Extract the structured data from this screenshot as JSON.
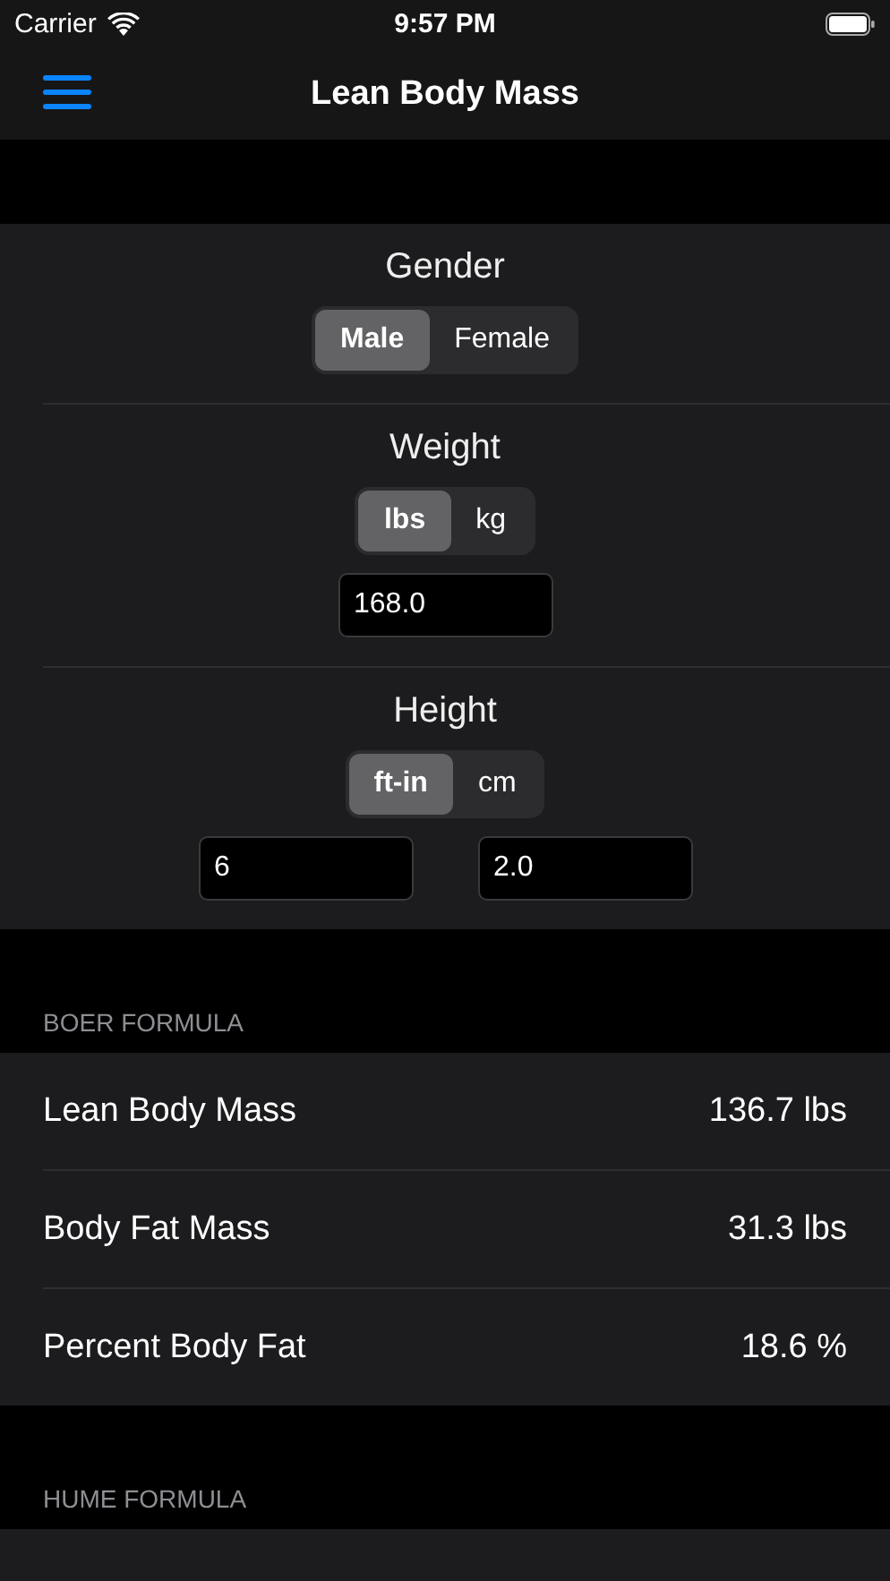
{
  "status_bar": {
    "carrier": "Carrier",
    "time": "9:57 PM"
  },
  "nav": {
    "title": "Lean Body Mass"
  },
  "inputs": [
    {
      "label": "Gender",
      "options": [
        {
          "label": "Male",
          "selected": true
        },
        {
          "label": "Female",
          "selected": false
        }
      ]
    },
    {
      "label": "Weight",
      "options": [
        {
          "label": "lbs",
          "selected": true
        },
        {
          "label": "kg",
          "selected": false
        }
      ],
      "fields": [
        "168.0"
      ]
    },
    {
      "label": "Height",
      "options": [
        {
          "label": "ft-in",
          "selected": true
        },
        {
          "label": "cm",
          "selected": false
        }
      ],
      "fields": [
        "6",
        "2.0"
      ]
    }
  ],
  "sections": [
    {
      "header": "BOER FORMULA",
      "rows": [
        {
          "label": "Lean Body Mass",
          "value": "136.7 lbs"
        },
        {
          "label": "Body Fat Mass",
          "value": "31.3 lbs"
        },
        {
          "label": "Percent Body Fat",
          "value": "18.6 %"
        }
      ]
    },
    {
      "header": "HUME FORMULA"
    }
  ]
}
